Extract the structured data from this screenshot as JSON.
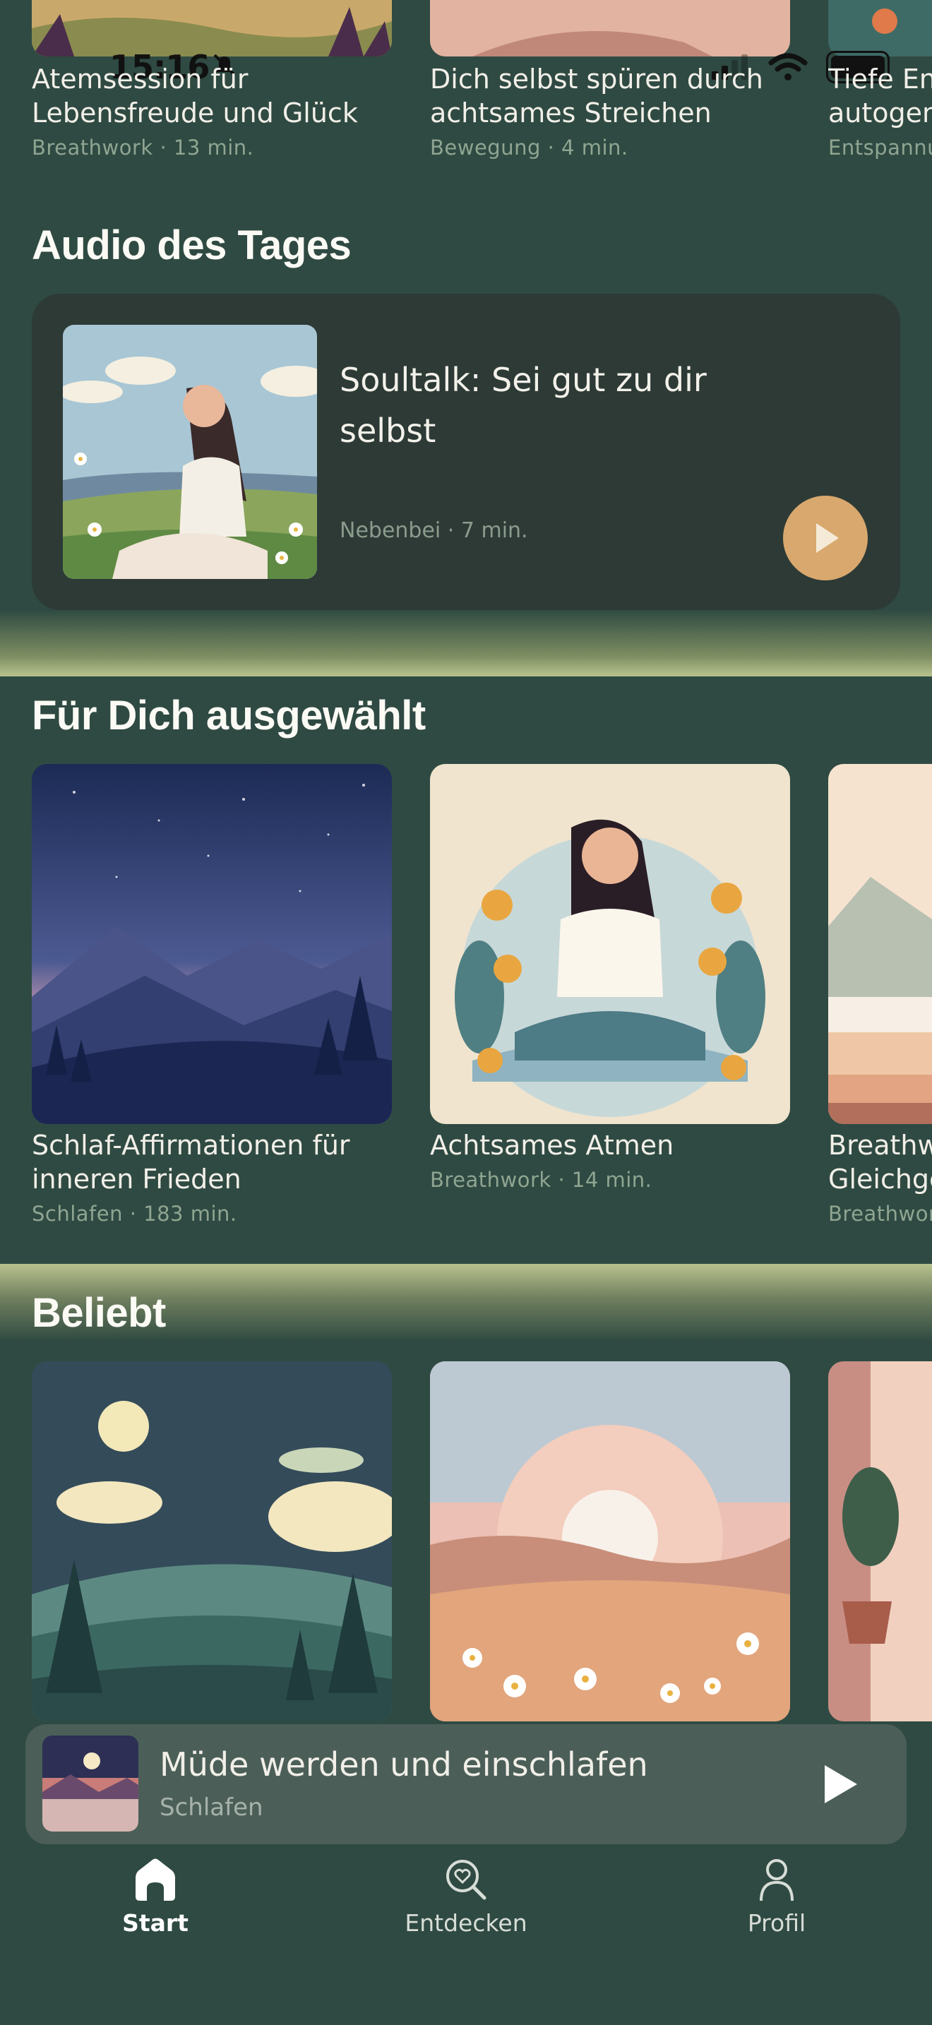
{
  "status_bar": {
    "time": "15:16"
  },
  "top_row": [
    {
      "title": "Atemsession für Lebensfreude und Glück",
      "meta": "Breathwork · 13 min."
    },
    {
      "title": "Dich selbst spüren durch achtsames Streichen",
      "meta": "Bewegung · 4 min."
    },
    {
      "title": "Tiefe Entspannung autogen",
      "meta": "Entspannung"
    }
  ],
  "audio_of_day": {
    "heading": "Audio des Tages",
    "title": "Soultalk: Sei gut zu dir selbst",
    "meta": "Nebenbei · 7 min."
  },
  "for_you": {
    "heading": "Für Dich ausgewählt",
    "items": [
      {
        "title": "Schlaf-Affirmationen für inneren Frieden",
        "meta": "Schlafen · 183 min."
      },
      {
        "title": "Achtsames Atmen",
        "meta": "Breathwork · 14 min."
      },
      {
        "title": "Breathwork Gleichgewicht",
        "meta": "Breathwork"
      }
    ]
  },
  "popular": {
    "heading": "Beliebt"
  },
  "mini_player": {
    "title": "Müde werden und einschlafen",
    "subtitle": "Schlafen"
  },
  "tabs": [
    {
      "label": "Start",
      "icon": "home-icon",
      "active": true
    },
    {
      "label": "Entdecken",
      "icon": "discover-icon",
      "active": false
    },
    {
      "label": "Profil",
      "icon": "profile-icon",
      "active": false
    }
  ],
  "colors": {
    "background": "#2f4a42",
    "card": "#2d3a36",
    "accent": "#d8a86e",
    "meta_text": "#8fa592"
  }
}
